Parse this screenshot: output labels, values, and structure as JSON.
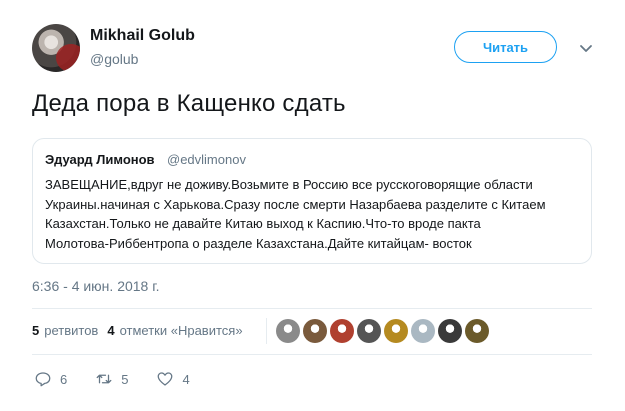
{
  "author": {
    "name": "Mikhail Golub",
    "handle": "@golub"
  },
  "follow_button": {
    "label": "Читать"
  },
  "tweet": {
    "text": "Деда пора в Кащенко сдать",
    "timestamp": "6:36 - 4 июн. 2018 г."
  },
  "quoted": {
    "name": "Эдуард Лимонов",
    "handle": "@edvlimonov",
    "lines": [
      "ЗАВЕЩАНИЕ,вдруг не доживу.Возьмите в Россию все русскоговорящие области",
      "Украины.начиная с Харькова.Сразу после смерти Назарбаева разделите с Китаем",
      "Казахстан.Только не давайте Китаю выход к Каспию.Что-то вроде пакта",
      "Молотова-Риббентропа о разделе Казахстана.Дайте китайцам- восток"
    ]
  },
  "stats": {
    "retweets_count": "5",
    "retweets_label": "ретвитов",
    "likes_count": "4",
    "likes_label": "отметки «Нравится»"
  },
  "liker_avatars": [
    {
      "color": "#8a8a8a"
    },
    {
      "color": "#7a5a3c"
    },
    {
      "color": "#b0402f"
    },
    {
      "color": "#555555"
    },
    {
      "color": "#b58a20"
    },
    {
      "color": "#aab8c2"
    },
    {
      "color": "#3a3a3a"
    },
    {
      "color": "#6b5a2a"
    }
  ],
  "actions": {
    "reply_count": "6",
    "retweet_count": "5",
    "like_count": "4"
  },
  "colors": {
    "accent": "#1da1f2",
    "secondary_text": "#657786",
    "border": "#e1e8ed"
  }
}
